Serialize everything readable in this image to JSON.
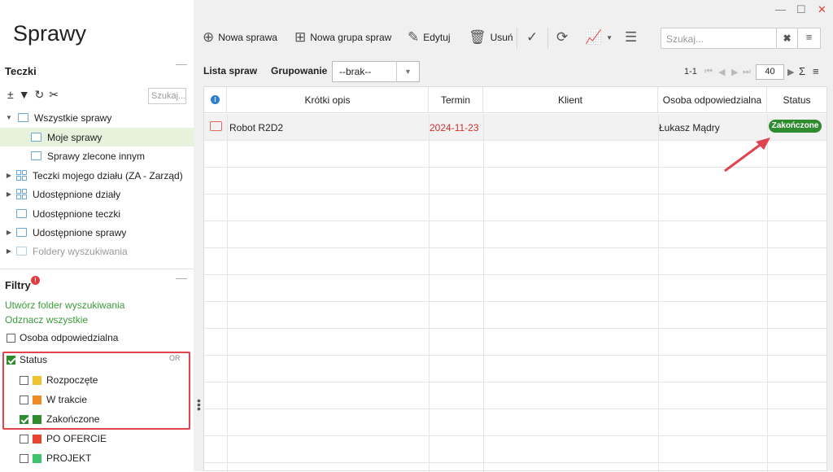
{
  "app_title": "Sprawy",
  "window": {
    "minimize": "—",
    "maximize": "☐",
    "close": "✕"
  },
  "teczki": {
    "heading": "Teczki",
    "search_placeholder": "Szukaj...",
    "items": [
      {
        "label": "Wszystkie sprawy"
      },
      {
        "label": "Moje sprawy"
      },
      {
        "label": "Sprawy zlecone innym"
      },
      {
        "label": "Teczki mojego działu (ZA - Zarząd)"
      },
      {
        "label": "Udostępnione działy"
      },
      {
        "label": "Udostępnione teczki"
      },
      {
        "label": "Udostępnione sprawy"
      },
      {
        "label": "Foldery wyszukiwania"
      }
    ]
  },
  "filtry": {
    "heading": "Filtry",
    "create_link": "Utwórz folder wyszukiwania",
    "clear_link": "Odznacz wszystkie",
    "osoba": "Osoba odpowiedzialna",
    "status": "Status",
    "or_tag": "OR",
    "options": [
      {
        "label": "Rozpoczęte",
        "color": "#f2c12e",
        "checked": false
      },
      {
        "label": "W trakcie",
        "color": "#f08a24",
        "checked": false
      },
      {
        "label": "Zakończone",
        "color": "#2e8b2e",
        "checked": true
      },
      {
        "label": "PO OFERCIE",
        "color": "#e8452c",
        "checked": false
      },
      {
        "label": "PROJEKT",
        "color": "#3ec46d",
        "checked": false
      }
    ]
  },
  "toolbar": {
    "new_case": "Nowa sprawa",
    "new_group": "Nowa grupa spraw",
    "edit": "Edytuj",
    "delete": "Usuń",
    "search_placeholder": "Szukaj..."
  },
  "list": {
    "title": "Lista spraw",
    "grouping_label": "Grupowanie",
    "grouping_value": "--brak--",
    "range": "1-1",
    "page_size": "40"
  },
  "table": {
    "headers": {
      "info": "i",
      "desc": "Krótki opis",
      "term": "Termin",
      "client": "Klient",
      "person": "Osoba odpowiedzialna",
      "status": "Status"
    },
    "rows": [
      {
        "desc": "Robot R2D2",
        "term": "2024-11-23",
        "client": "",
        "person": "Łukasz Mądry",
        "status": "Zakończone"
      }
    ]
  }
}
